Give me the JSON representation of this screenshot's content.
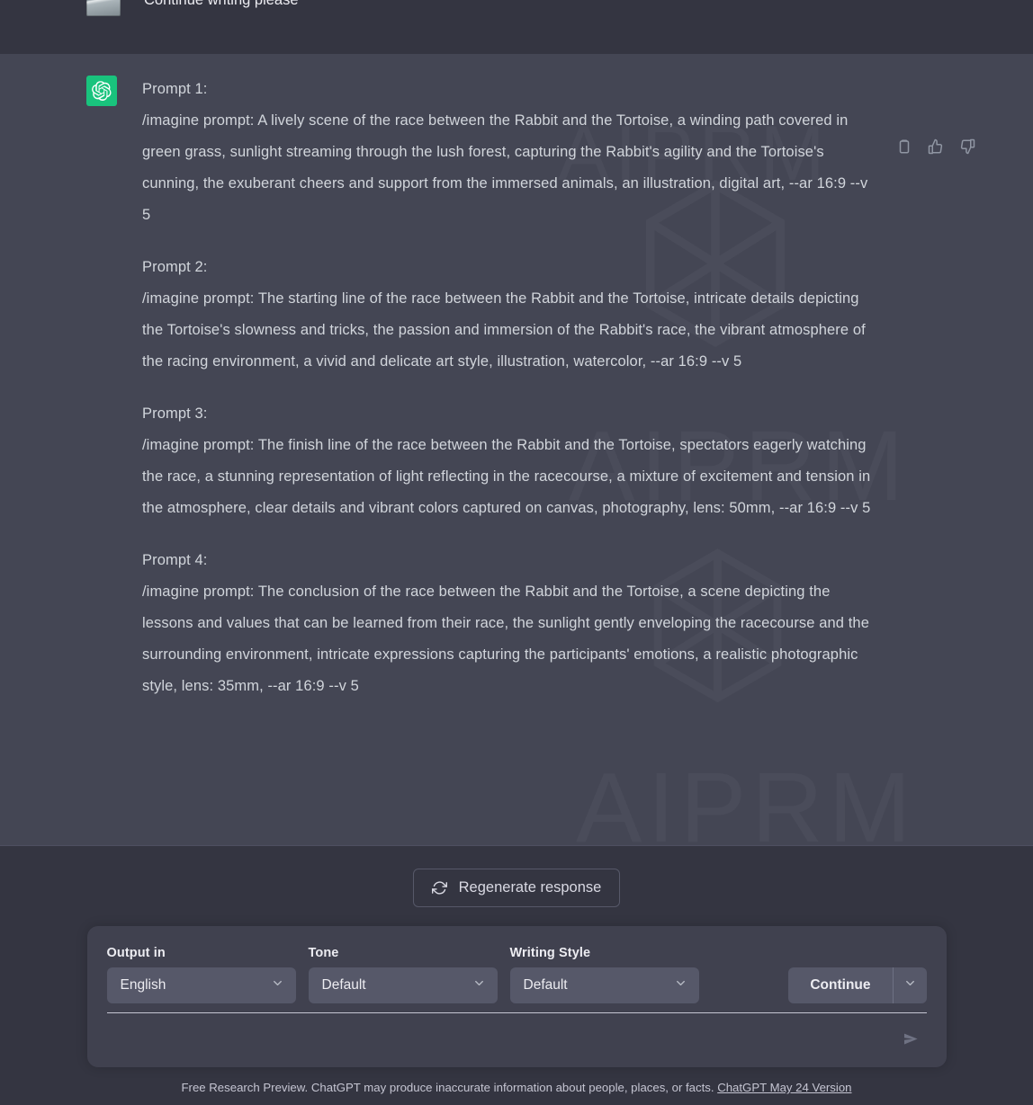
{
  "user_message": {
    "text": "Continue writing please",
    "avatar": "user-photo-avatar"
  },
  "assistant_message": {
    "avatar_icon": "openai-logo-icon",
    "watermark": "AIPRM",
    "actions": [
      {
        "name": "copy-icon",
        "label": "Copy"
      },
      {
        "name": "thumbs-up-icon",
        "label": "Good response"
      },
      {
        "name": "thumbs-down-icon",
        "label": "Bad response"
      }
    ],
    "prompts": [
      {
        "title": "Prompt 1:",
        "text": "/imagine prompt: A lively scene of the race between the Rabbit and the Tortoise, a winding path covered in green grass, sunlight streaming through the lush forest, capturing the Rabbit's agility and the Tortoise's cunning, the exuberant cheers and support from the immersed animals, an illustration, digital art, --ar 16:9 --v 5"
      },
      {
        "title": "Prompt 2:",
        "text": "/imagine prompt: The starting line of the race between the Rabbit and the Tortoise, intricate details depicting the Tortoise's slowness and tricks, the passion and immersion of the Rabbit's race, the vibrant atmosphere of the racing environment, a vivid and delicate art style, illustration, watercolor, --ar 16:9 --v 5"
      },
      {
        "title": "Prompt 3:",
        "text": "/imagine prompt: The finish line of the race between the Rabbit and the Tortoise, spectators eagerly watching the race, a stunning representation of light reflecting in the racecourse, a mixture of excitement and tension in the atmosphere, clear details and vibrant colors captured on canvas, photography, lens: 50mm, --ar 16:9 --v 5"
      },
      {
        "title": "Prompt 4:",
        "text": "/imagine prompt: The conclusion of the race between the Rabbit and the Tortoise, a scene depicting the lessons and values that can be learned from their race, the sunlight gently enveloping the racecourse and the surrounding environment, intricate expressions capturing the participants' emotions, a realistic photographic style, lens: 35mm, --ar 16:9 --v 5"
      }
    ]
  },
  "regenerate": {
    "label": "Regenerate response",
    "icon": "refresh-icon"
  },
  "aiprm_panel": {
    "fields": [
      {
        "label": "Output in",
        "value": "English",
        "name": "output-language"
      },
      {
        "label": "Tone",
        "value": "Default",
        "name": "tone"
      },
      {
        "label": "Writing Style",
        "value": "Default",
        "name": "writing-style"
      }
    ],
    "continue_label": "Continue",
    "chat_input_placeholder": "",
    "chat_input_value": "",
    "send_icon": "send-icon"
  },
  "footer": {
    "text": "Free Research Preview. ChatGPT may produce inaccurate information about people, places, or facts.",
    "link_text": "ChatGPT May 24 Version"
  },
  "colors": {
    "user_bg": "#343541",
    "assistant_bg": "#444654",
    "accent_green": "#19c37d",
    "panel_bg": "#40414f",
    "control_bg": "#565869"
  }
}
